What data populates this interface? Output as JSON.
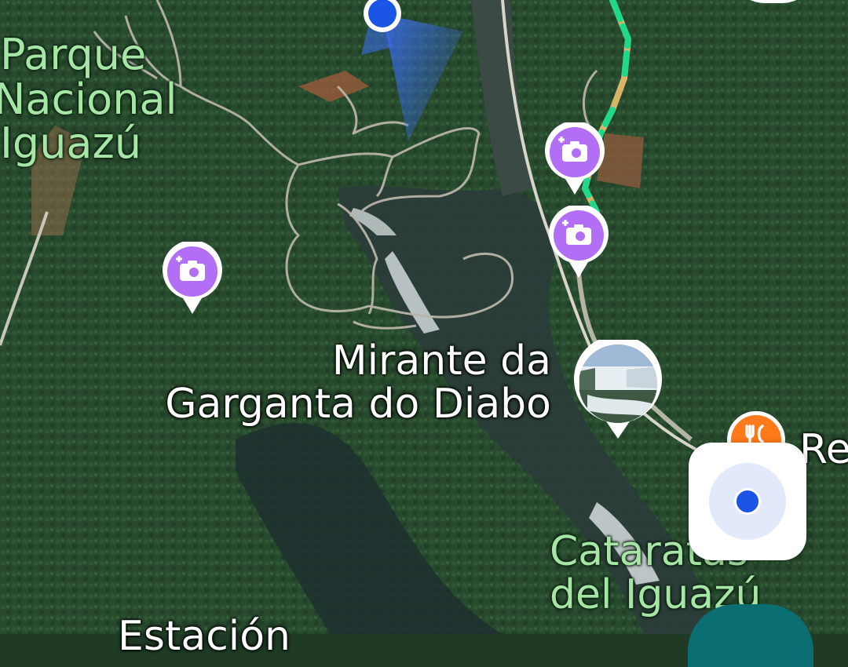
{
  "map": {
    "type": "satellite",
    "labels": {
      "park_name": [
        "Parque",
        "Nacional",
        "Iguazú"
      ],
      "viewpoint": [
        "Mirante da",
        "Garganta do Diabo"
      ],
      "falls": [
        "Cataratas",
        "del Iguazú"
      ],
      "restaurant_partial": "Re",
      "bottom_partial": "Estación"
    },
    "colors": {
      "forest": "#27492d",
      "river": "#2a3a3c",
      "trail": "#b8b4a8",
      "route_green": "#1fd88a",
      "route_tan": "#d9b36a",
      "photo_pin": "#b26ef5",
      "user_blue": "#1a55e6",
      "park_label": "#a6e6a4"
    },
    "pins": [
      {
        "kind": "add-photo",
        "icon": "camera-plus-icon"
      },
      {
        "kind": "add-photo",
        "icon": "camera-plus-icon"
      },
      {
        "kind": "add-photo",
        "icon": "camera-plus-icon"
      },
      {
        "kind": "place-photo",
        "icon": "waterfall-photo"
      },
      {
        "kind": "restaurant",
        "icon": "fork-knife-icon"
      }
    ]
  },
  "controls": {
    "my_location_icon": "my-location-icon"
  }
}
